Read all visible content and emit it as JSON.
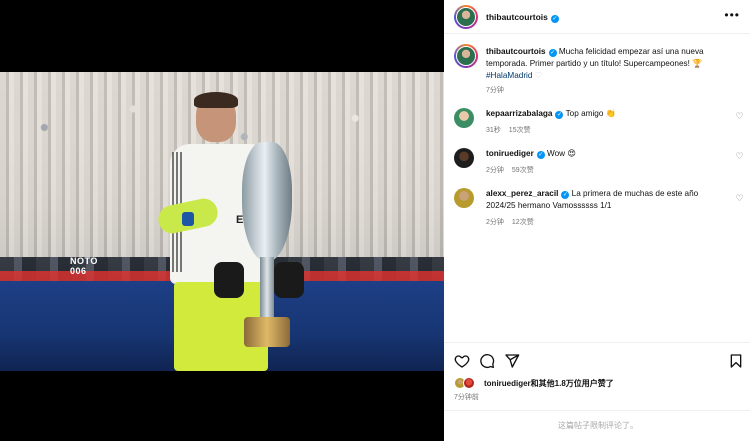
{
  "post": {
    "author": "thibautcourtois",
    "caption": "Mucha felicidad empezar así una nueva temporada. Primer partido y un título! Supercampeones! 🏆",
    "hashtag": "#HalaMadrid",
    "time": "7分钟",
    "photo": {
      "board_text": "NOTO",
      "board_number": "006",
      "shirt_brand": "EMI"
    }
  },
  "comments": [
    {
      "user": "kepaarrizabalaga",
      "text": "Top amigo 👏",
      "time": "31秒",
      "likes": "15次赞"
    },
    {
      "user": "toniruediger",
      "text": "Wow 😍",
      "time": "2分钟",
      "likes": "59次赞"
    },
    {
      "user": "alexx_perez_aracil",
      "text": "La primera de muchas de este año 2024/25 hermano Vamossssss 1/1",
      "time": "2分钟",
      "likes": "12次赞"
    }
  ],
  "likes_summary": {
    "user": "toniruediger",
    "rest": "和其他1.8万位用户赞了"
  },
  "bottom_time": "7分钟前",
  "comments_restricted": "这篇帖子限制评论了。",
  "icons": {
    "heart": "heart-icon",
    "comment": "comment-icon",
    "share": "share-icon",
    "bookmark": "bookmark-icon",
    "more": "more-options-icon",
    "verified": "verified-badge-icon"
  },
  "colors": {
    "verified": "#0095f6",
    "hashtag": "#00376b",
    "muted": "#737373"
  }
}
